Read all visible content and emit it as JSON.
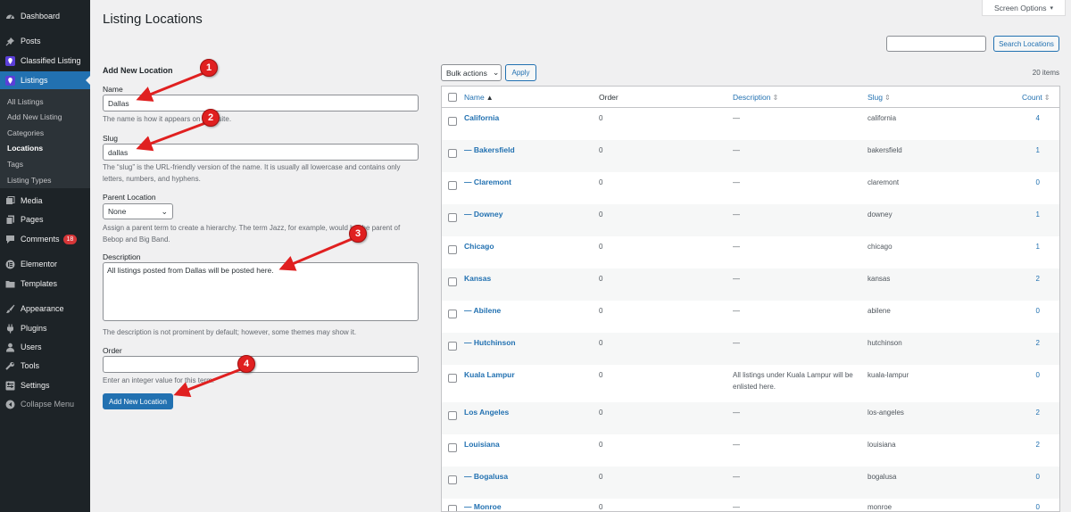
{
  "sidebar": {
    "items": [
      {
        "label": "Dashboard",
        "icon": "dashboard-icon"
      },
      {
        "label": "Posts",
        "icon": "pin-icon"
      },
      {
        "label": "Classified Listing",
        "icon": "location-pin-icon"
      },
      {
        "label": "Listings",
        "icon": "location-pin-icon"
      },
      {
        "label": "Media",
        "icon": "media-icon"
      },
      {
        "label": "Pages",
        "icon": "pages-icon"
      },
      {
        "label": "Comments",
        "icon": "comments-icon",
        "badge": "18"
      },
      {
        "label": "Elementor",
        "icon": "elementor-icon"
      },
      {
        "label": "Templates",
        "icon": "folder-icon"
      },
      {
        "label": "Appearance",
        "icon": "brush-icon"
      },
      {
        "label": "Plugins",
        "icon": "plugin-icon"
      },
      {
        "label": "Users",
        "icon": "users-icon"
      },
      {
        "label": "Tools",
        "icon": "wrench-icon"
      },
      {
        "label": "Settings",
        "icon": "settings-icon"
      },
      {
        "label": "Collapse Menu",
        "icon": "collapse-icon"
      }
    ],
    "submenu": [
      {
        "label": "All Listings"
      },
      {
        "label": "Add New Listing"
      },
      {
        "label": "Categories"
      },
      {
        "label": "Locations"
      },
      {
        "label": "Tags"
      },
      {
        "label": "Listing Types"
      }
    ]
  },
  "header": {
    "title": "Listing Locations",
    "screen_options": "Screen Options"
  },
  "form": {
    "heading": "Add New Location",
    "name_label": "Name",
    "name_value": "Dallas",
    "name_help": "The name is how it appears on your site.",
    "slug_label": "Slug",
    "slug_value": "dallas",
    "slug_help": "The “slug” is the URL-friendly version of the name. It is usually all lowercase and contains only letters, numbers, and hyphens.",
    "parent_label": "Parent Location",
    "parent_value": "None",
    "parent_help": "Assign a parent term to create a hierarchy. The term Jazz, for example, would be the parent of Bebop and Big Band.",
    "description_label": "Description",
    "description_value": "All listings posted from Dallas will be posted here.",
    "description_help": "The description is not prominent by default; however, some themes may show it.",
    "order_label": "Order",
    "order_value": "",
    "order_help": "Enter an integer value for this term.",
    "submit_label": "Add New Location"
  },
  "table_controls": {
    "search_placeholder": "",
    "search_button": "Search Locations",
    "bulk_actions": "Bulk actions",
    "apply": "Apply",
    "item_count": "20 items"
  },
  "table": {
    "columns": [
      "Name",
      "Order",
      "Description",
      "Slug",
      "Count"
    ],
    "rows": [
      {
        "name": "California",
        "order": "0",
        "description": "—",
        "slug": "california",
        "count": "4"
      },
      {
        "name": "— Bakersfield",
        "order": "0",
        "description": "—",
        "slug": "bakersfield",
        "count": "1"
      },
      {
        "name": "— Claremont",
        "order": "0",
        "description": "—",
        "slug": "claremont",
        "count": "0"
      },
      {
        "name": "— Downey",
        "order": "0",
        "description": "—",
        "slug": "downey",
        "count": "1"
      },
      {
        "name": "Chicago",
        "order": "0",
        "description": "—",
        "slug": "chicago",
        "count": "1"
      },
      {
        "name": "Kansas",
        "order": "0",
        "description": "—",
        "slug": "kansas",
        "count": "2"
      },
      {
        "name": "— Abilene",
        "order": "0",
        "description": "—",
        "slug": "abilene",
        "count": "0"
      },
      {
        "name": "— Hutchinson",
        "order": "0",
        "description": "—",
        "slug": "hutchinson",
        "count": "2"
      },
      {
        "name": "Kuala Lampur",
        "order": "0",
        "description": "All listings under Kuala Lampur will be enlisted here.",
        "slug": "kuala-lampur",
        "count": "0"
      },
      {
        "name": "Los Angeles",
        "order": "0",
        "description": "—",
        "slug": "los-angeles",
        "count": "2"
      },
      {
        "name": "Louisiana",
        "order": "0",
        "description": "—",
        "slug": "louisiana",
        "count": "2"
      },
      {
        "name": "— Bogalusa",
        "order": "0",
        "description": "—",
        "slug": "bogalusa",
        "count": "0"
      },
      {
        "name": "— Monroe",
        "order": "0",
        "description": "—",
        "slug": "monroe",
        "count": "0"
      }
    ]
  },
  "annotations": {
    "markers": [
      "1",
      "2",
      "3",
      "4"
    ],
    "color": "#e02020"
  },
  "colors": {
    "sidebar_bg": "#1d2327",
    "accent": "#2271b1",
    "badge": "#d63638"
  }
}
